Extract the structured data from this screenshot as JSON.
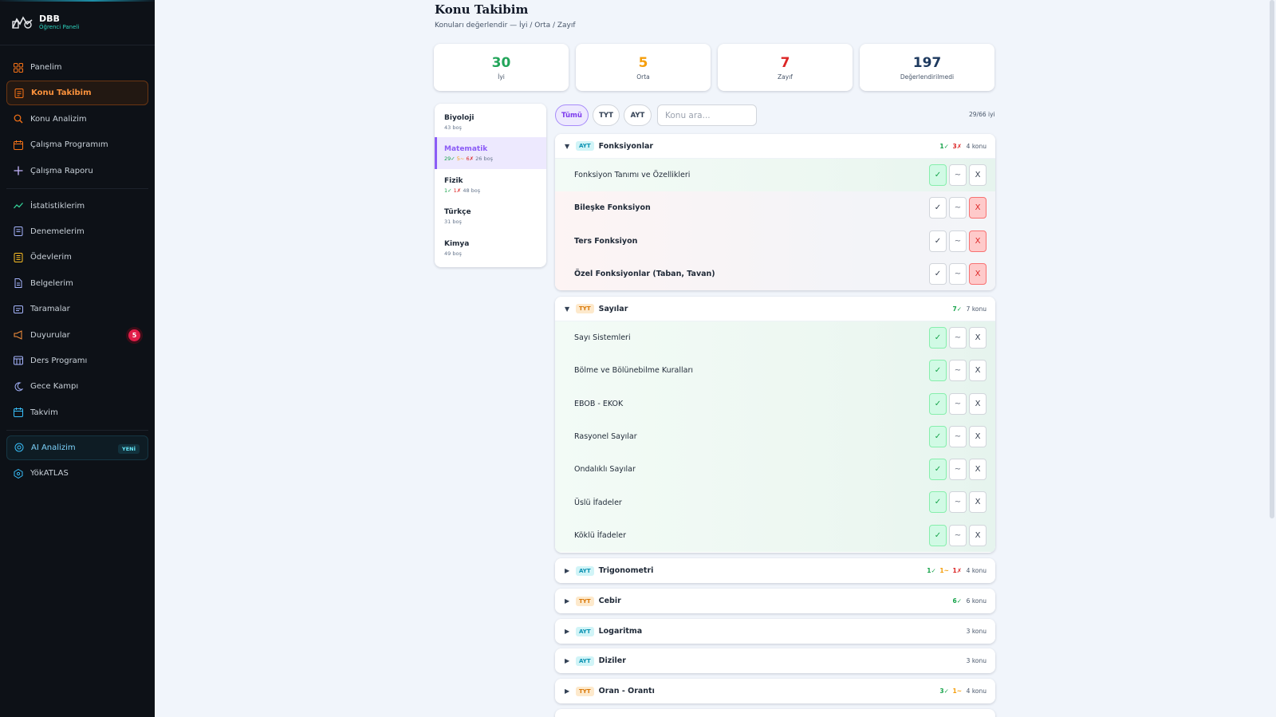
{
  "brand": {
    "title": "DBB",
    "subtitle": "Öğrenci Paneli"
  },
  "nav": [
    {
      "label": "Panelim",
      "icon": "grid-icon"
    },
    {
      "label": "Konu Takibim",
      "icon": "checklist-icon",
      "active": true
    },
    {
      "label": "Konu Analizim",
      "icon": "search-icon"
    },
    {
      "label": "Çalışma Programım",
      "icon": "calendar-icon"
    },
    {
      "label": "Çalışma Raporu",
      "icon": "plus-icon"
    },
    {
      "label": "İstatistiklerim",
      "icon": "trend-icon"
    },
    {
      "label": "Denemelerim",
      "icon": "document-icon"
    },
    {
      "label": "Ödevlerim",
      "icon": "notebook-icon"
    },
    {
      "label": "Belgelerim",
      "icon": "file-icon"
    },
    {
      "label": "Taramalar",
      "icon": "scan-icon"
    },
    {
      "label": "Duyurular",
      "icon": "megaphone-icon",
      "badge": "5"
    },
    {
      "label": "Ders Programı",
      "icon": "schedule-icon"
    },
    {
      "label": "Gece Kampı",
      "icon": "moon-icon"
    },
    {
      "label": "Takvim",
      "icon": "calendar-icon"
    },
    {
      "label": "AI Analizim",
      "icon": "ai-icon",
      "badge": "YENİ"
    },
    {
      "label": "YökATLAS",
      "icon": "hexagon-icon"
    }
  ],
  "header": {
    "title": "Konu Takibim",
    "subtitle": "Konuları değerlendir — İyi / Orta / Zayıf"
  },
  "stats": [
    {
      "value": "30",
      "label": "İyi",
      "color": "#22a55a"
    },
    {
      "value": "5",
      "label": "Orta",
      "color": "#f59e0b"
    },
    {
      "value": "7",
      "label": "Zayıf",
      "color": "#dc2626"
    },
    {
      "value": "197",
      "label": "Değerlendirilmedi",
      "color": "#1e3a5f"
    }
  ],
  "subjects": [
    {
      "name": "Biyoloji",
      "empty": "43 boş"
    },
    {
      "name": "Matematik",
      "good": "29✓",
      "mid": "5~",
      "bad": "6✗",
      "empty": "26 boş",
      "active": true
    },
    {
      "name": "Fizik",
      "good": "1✓",
      "bad": "1✗",
      "empty": "48 boş"
    },
    {
      "name": "Türkçe",
      "empty": "31 boş"
    },
    {
      "name": "Kimya",
      "empty": "49 boş"
    }
  ],
  "filters": {
    "all": "Tümü",
    "tyt": "TYT",
    "ayt": "AYT",
    "search_placeholder": "Konu ara...",
    "counter": "29/66 iyi"
  },
  "buttons": {
    "good": "✓",
    "mid": "~",
    "bad": "X"
  },
  "groups": [
    {
      "tag": "AYT",
      "name": "Fonksiyonlar",
      "open": true,
      "good": "1✓",
      "bad": "3✗",
      "count": "4 konu",
      "topics": [
        {
          "name": "Fonksiyon Tanımı ve Özellikleri",
          "state": "good"
        },
        {
          "name": "Bileşke Fonksiyon",
          "state": "bad"
        },
        {
          "name": "Ters Fonksiyon",
          "state": "bad"
        },
        {
          "name": "Özel Fonksiyonlar (Taban, Tavan)",
          "state": "bad"
        }
      ]
    },
    {
      "tag": "TYT",
      "name": "Sayılar",
      "open": true,
      "good": "7✓",
      "count": "7 konu",
      "topics": [
        {
          "name": "Sayı Sistemleri",
          "state": "good"
        },
        {
          "name": "Bölme ve Bölünebilme Kuralları",
          "state": "good"
        },
        {
          "name": "EBOB - EKOK",
          "state": "good"
        },
        {
          "name": "Rasyonel Sayılar",
          "state": "good"
        },
        {
          "name": "Ondalıklı Sayılar",
          "state": "good"
        },
        {
          "name": "Üslü İfadeler",
          "state": "good"
        },
        {
          "name": "Köklü İfadeler",
          "state": "good"
        }
      ]
    },
    {
      "tag": "AYT",
      "name": "Trigonometri",
      "good": "1✓",
      "mid": "1~",
      "bad": "1✗",
      "count": "4 konu"
    },
    {
      "tag": "TYT",
      "name": "Cebir",
      "good": "6✓",
      "count": "6 konu"
    },
    {
      "tag": "AYT",
      "name": "Logaritma",
      "count": "3 konu"
    },
    {
      "tag": "AYT",
      "name": "Diziler",
      "count": "3 konu"
    },
    {
      "tag": "TYT",
      "name": "Oran - Orantı",
      "good": "3✓",
      "mid": "1~",
      "count": "4 konu"
    }
  ]
}
